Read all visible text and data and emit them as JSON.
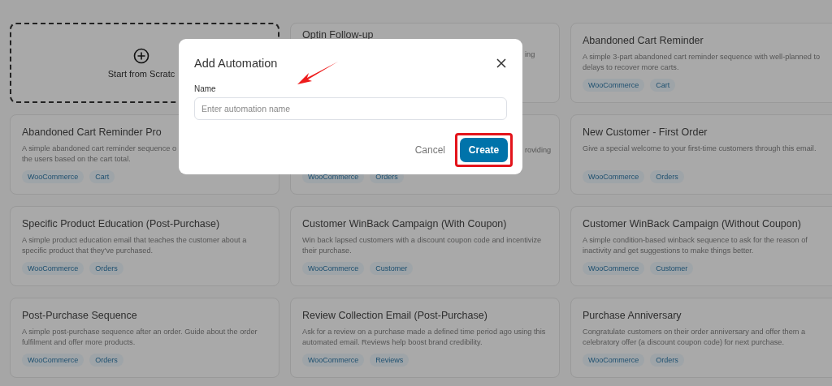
{
  "cards": [
    {
      "kind": "scratch",
      "title": "Start from Scratc"
    },
    {
      "kind": "covered",
      "title": "Optin Follow-up",
      "lines": [
        "ing"
      ]
    },
    {
      "kind": "template",
      "title": "Abandoned Cart Reminder",
      "lines": [
        "A simple 3-part abandoned cart reminder sequence with well-planned to",
        "delays to recover more carts."
      ],
      "tags": [
        "WooCommerce",
        "Cart"
      ]
    },
    {
      "kind": "template",
      "title": "Abandoned Cart Reminder Pro",
      "lines": [
        "A simple abandoned cart reminder sequence o",
        "the users based on the cart total."
      ],
      "tags": [
        "WooCommerce",
        "Cart"
      ]
    },
    {
      "kind": "covered",
      "lines": [
        "roviding"
      ],
      "tags": [
        "WooCommerce",
        "Orders"
      ]
    },
    {
      "kind": "template",
      "title": "New Customer - First Order",
      "lines": [
        "Give a special welcome to your first-time customers through this email."
      ],
      "tags": [
        "WooCommerce",
        "Orders"
      ]
    },
    {
      "kind": "template",
      "title": "Specific Product Education (Post-Purchase)",
      "lines": [
        "A simple product education email that teaches the customer about a",
        "specific product that they've purchased."
      ],
      "tags": [
        "WooCommerce",
        "Orders"
      ]
    },
    {
      "kind": "template",
      "title": "Customer WinBack Campaign (With Coupon)",
      "lines": [
        "Win back lapsed customers with a discount coupon code and incentivize",
        "their purchase."
      ],
      "tags": [
        "WooCommerce",
        "Customer"
      ]
    },
    {
      "kind": "template",
      "title": "Customer WinBack Campaign (Without Coupon)",
      "lines": [
        "A simple condition-based winback sequence to ask for the reason of",
        "inactivity and get suggestions to make things better."
      ],
      "tags": [
        "WooCommerce",
        "Customer"
      ]
    },
    {
      "kind": "template",
      "title": "Post-Purchase Sequence",
      "lines": [
        "A simple post-purchase sequence after an order. Guide about the order",
        "fulfilment and offer more products."
      ],
      "tags": [
        "WooCommerce",
        "Orders"
      ]
    },
    {
      "kind": "template",
      "title": "Review Collection Email (Post-Purchase)",
      "lines": [
        "Ask for a review on a purchase made a defined time period ago using this",
        "automated email. Reviews help boost brand credibility."
      ],
      "tags": [
        "WooCommerce",
        "Reviews"
      ]
    },
    {
      "kind": "template",
      "title": "Purchase Anniversary",
      "lines": [
        "Congratulate customers on their order anniversary and offer them a",
        "celebratory offer (a discount coupon code) for next purchase."
      ],
      "tags": [
        "WooCommerce",
        "Orders"
      ]
    }
  ],
  "modal": {
    "title": "Add Automation",
    "field": {
      "label": "Name",
      "placeholder": "Enter automation name"
    },
    "cancel": "Cancel",
    "create": "Create",
    "create_highlighted": true
  }
}
